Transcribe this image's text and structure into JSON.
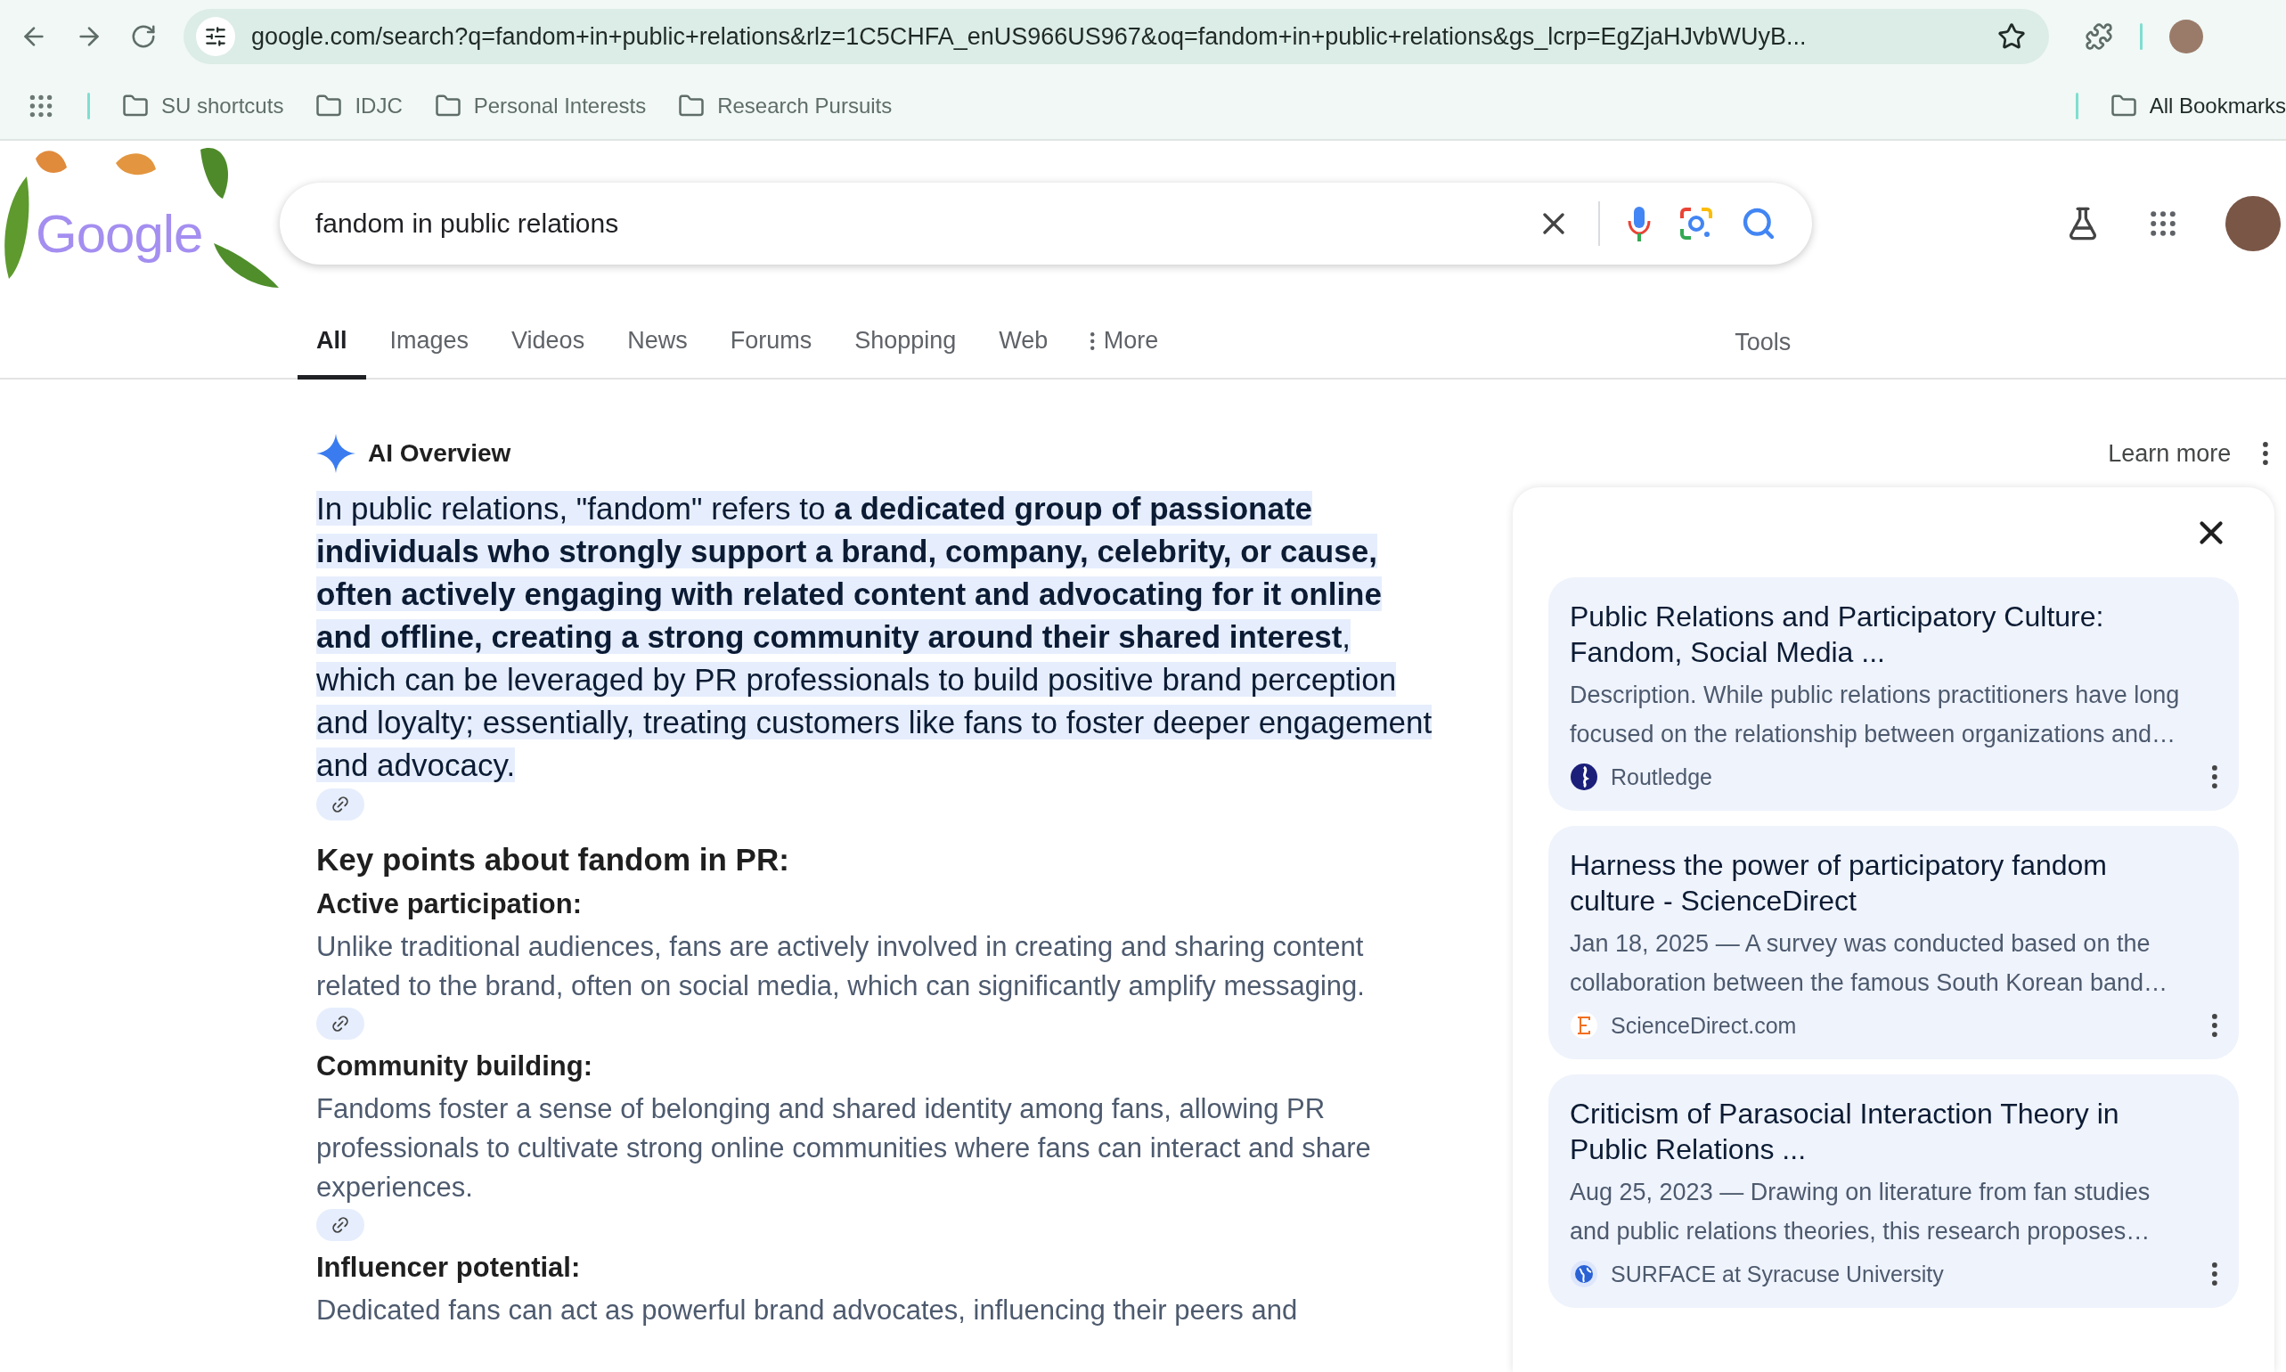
{
  "browser": {
    "url": "google.com/search?q=fandom+in+public+relations&rlz=1C5CHFA_enUS966US967&oq=fandom+in+public+relations&gs_lcrp=EgZjaHJvbWUyB...",
    "bookmarked": false,
    "bookmarks": [
      "SU shortcuts",
      "IDJC",
      "Personal Interests",
      "Research Pursuits"
    ],
    "all_bookmarks": "All Bookmarks"
  },
  "search": {
    "logo": "Google",
    "query": "fandom in public relations"
  },
  "tabs": [
    {
      "label": "All",
      "selected": true,
      "kind": "link"
    },
    {
      "label": "Images",
      "selected": false,
      "kind": "link"
    },
    {
      "label": "Videos",
      "selected": false,
      "kind": "link"
    },
    {
      "label": "News",
      "selected": false,
      "kind": "link"
    },
    {
      "label": "Forums",
      "selected": false,
      "kind": "link"
    },
    {
      "label": "Shopping",
      "selected": false,
      "kind": "link"
    },
    {
      "label": "Web",
      "selected": false,
      "kind": "link"
    },
    {
      "label": "More",
      "selected": false,
      "kind": "menu"
    }
  ],
  "tools": "Tools",
  "overview": {
    "title": "AI Overview",
    "learn_more": "Learn more",
    "summary": "In public relations, \"fandom\" refers to **a dedicated group of passionate individuals who strongly support a brand, company, celebrity, or cause, often actively engaging with related content and advocating for it online and offline, creating a strong community around their shared interest**, which can be leveraged by PR professionals to build positive brand perception and loyalty; essentially, treating customers like fans to foster deeper engagement and advocacy.",
    "key_points_title": "Key points about fandom in PR:",
    "key_points": [
      {
        "title": "Active participation:",
        "text": "Unlike traditional audiences, fans are actively involved in creating and sharing content related to the brand, often on social media, which can significantly amplify messaging.",
        "cited": true
      },
      {
        "title": "Community building:",
        "text": "Fandoms foster a sense of belonging and shared identity among fans, allowing PR professionals to cultivate strong online communities where fans can interact and share experiences.",
        "cited": true
      },
      {
        "title": "Influencer potential:",
        "text": "Dedicated fans can act as powerful brand advocates, influencing their peers and",
        "cited": false
      }
    ]
  },
  "sources": [
    {
      "title": "Public Relations and Participatory Culture: Fandom, Social Media ...",
      "snippet": "Description. While public relations practitioners have long focused on the relationship between organizations and…",
      "source": "Routledge",
      "kind": "routledge"
    },
    {
      "title": "Harness the power of participatory fandom culture - ScienceDirect",
      "snippet": "Jan 18, 2025 — A survey was conducted based on the collaboration between the famous South Korean band…",
      "source": "ScienceDirect.com",
      "kind": "elsevier"
    },
    {
      "title": "Criticism of Parasocial Interaction Theory in Public Relations ...",
      "snippet": "Aug 25, 2023 — Drawing on literature from fan studies and public relations theories, this research proposes…",
      "source": "SURFACE at Syracuse University",
      "kind": "globe"
    }
  ]
}
